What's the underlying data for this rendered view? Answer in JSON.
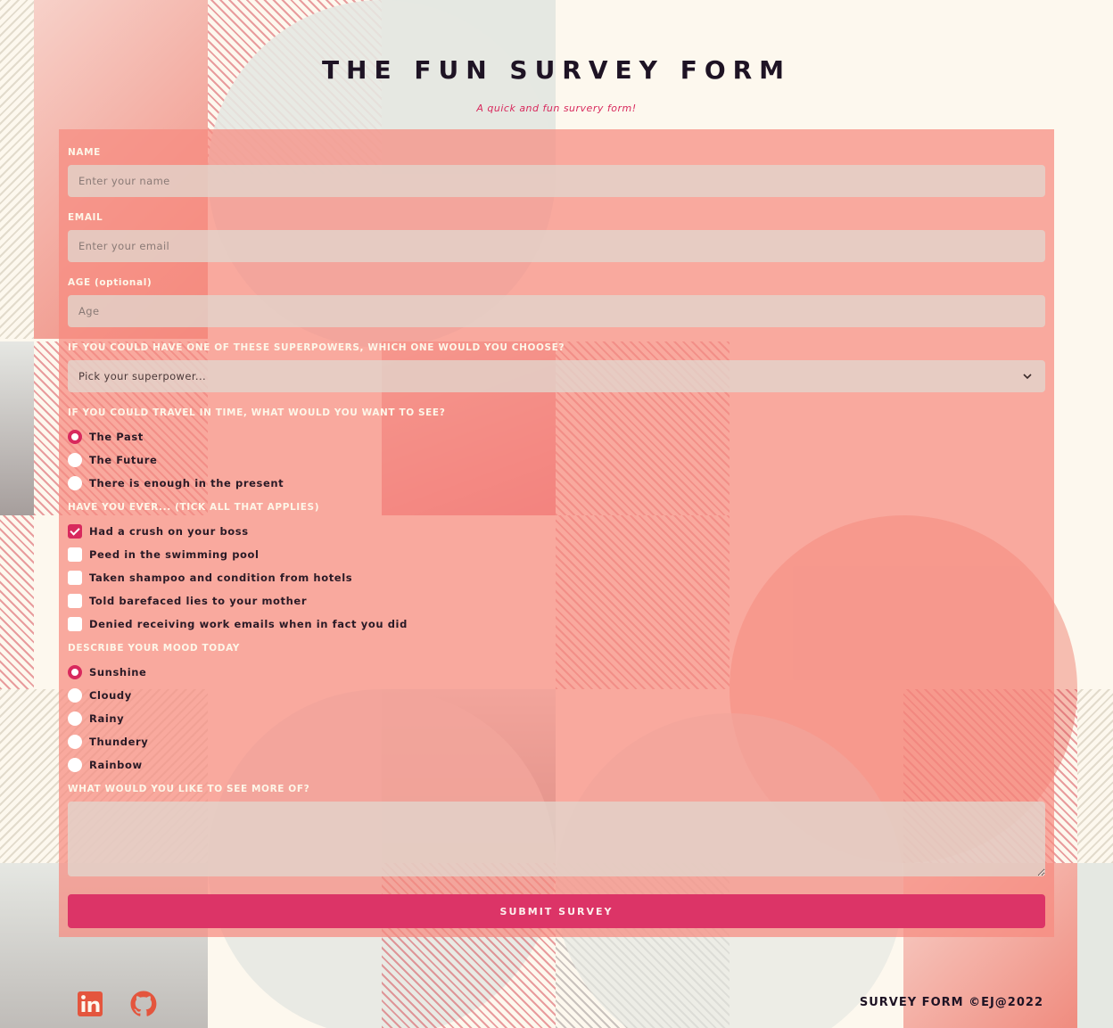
{
  "header": {
    "title": "THE FUN SURVEY FORM",
    "subtitle": "A quick and fun survery form!"
  },
  "form": {
    "name": {
      "label": "NAME",
      "placeholder": "Enter your name"
    },
    "email": {
      "label": "EMAIL",
      "placeholder": "Enter your email"
    },
    "age": {
      "label": "AGE (optional)",
      "placeholder": "Age"
    },
    "superpower": {
      "label": "IF YOU COULD HAVE ONE OF THESE SUPERPOWERS, WHICH ONE WOULD YOU CHOOSE?",
      "selected": "Pick your superpower..."
    },
    "time_travel": {
      "label": "IF YOU COULD TRAVEL IN TIME, WHAT WOULD YOU WANT TO SEE?",
      "options": [
        "The Past",
        "The Future",
        "There is enough in the present"
      ],
      "selected_index": 0
    },
    "have_you_ever": {
      "label": "HAVE YOU EVER... (TICK ALL THAT APPLIES)",
      "options": [
        "Had a crush on your boss",
        "Peed in the swimming pool",
        "Taken shampoo and condition from hotels",
        "Told barefaced lies to your mother",
        "Denied receiving work emails when in fact you did"
      ],
      "checked": [
        true,
        false,
        false,
        false,
        false
      ]
    },
    "mood": {
      "label": "DESCRIBE YOUR MOOD TODAY",
      "options": [
        "Sunshine",
        "Cloudy",
        "Rainy",
        "Thundery",
        "Rainbow"
      ],
      "selected_index": 0
    },
    "more_of": {
      "label": "WHAT WOULD YOU LIKE TO SEE MORE OF?",
      "value": ""
    },
    "submit_label": "SUBMIT SURVEY"
  },
  "footer": {
    "text": "SURVEY FORM ©EJ@2022",
    "icons": [
      "linkedin-icon",
      "github-icon"
    ]
  },
  "colors": {
    "accent": "#dc3467",
    "background": "#fdf8ee",
    "form_bg": "#f68a80",
    "title": "#1e1324",
    "icon": "#e4553d"
  }
}
